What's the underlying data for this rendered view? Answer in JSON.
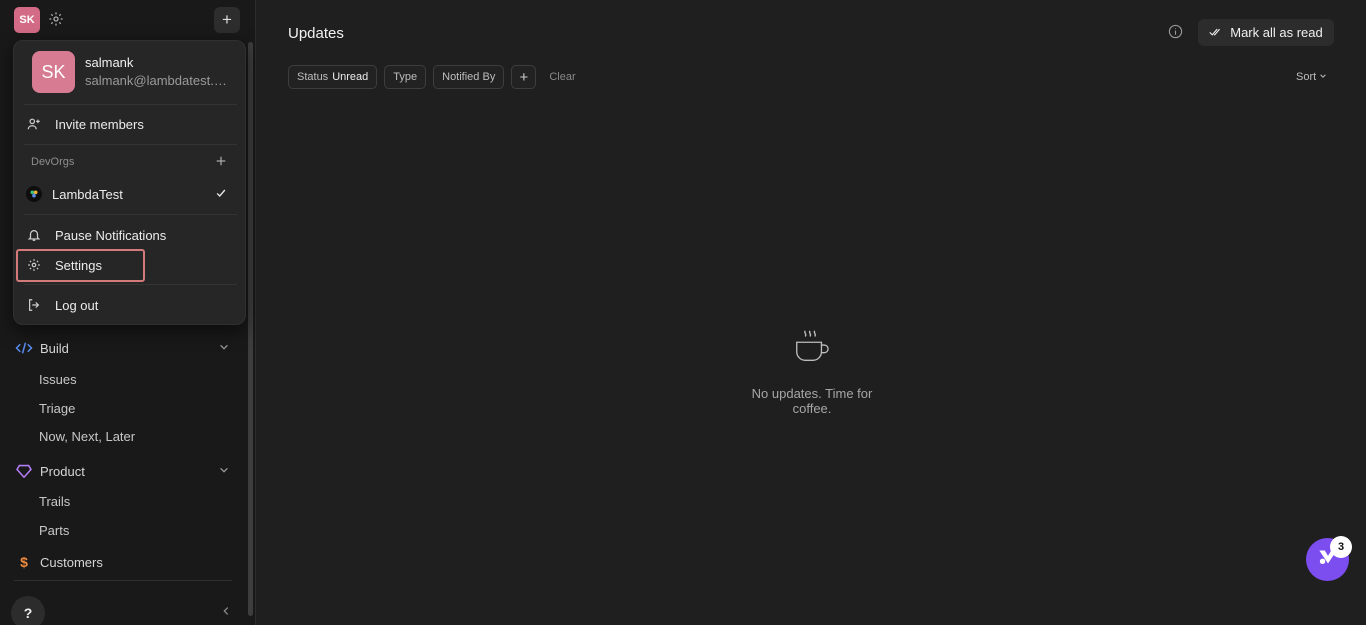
{
  "top": {
    "avatar_initials": "SK"
  },
  "menu": {
    "avatar_initials": "SK",
    "user_name": "salmank",
    "user_email": "salmank@lambdatest.c...",
    "invite_label": "Invite members",
    "devorgs_label": "DevOrgs",
    "org_name": "LambdaTest",
    "pause_label": "Pause Notifications",
    "settings_label": "Settings",
    "logout_label": "Log out"
  },
  "sidebar": {
    "build_label": "Build",
    "build_items": [
      "Issues",
      "Triage",
      "Now, Next, Later"
    ],
    "product_label": "Product",
    "product_items": [
      "Trails",
      "Parts"
    ],
    "customers_label": "Customers",
    "help_label": "?"
  },
  "main": {
    "title": "Updates",
    "mark_all_label": "Mark all as read",
    "filters": {
      "status_label": "Status",
      "status_value": "Unread",
      "type_label": "Type",
      "notified_label": "Notified By",
      "clear_label": "Clear"
    },
    "sort_label": "Sort",
    "empty_text": "No updates. Time for coffee."
  },
  "fab": {
    "badge_count": "3"
  },
  "colors": {
    "accent": "#7c4ef0",
    "avatar": "#d36b86",
    "highlight": "#d47a7a"
  }
}
